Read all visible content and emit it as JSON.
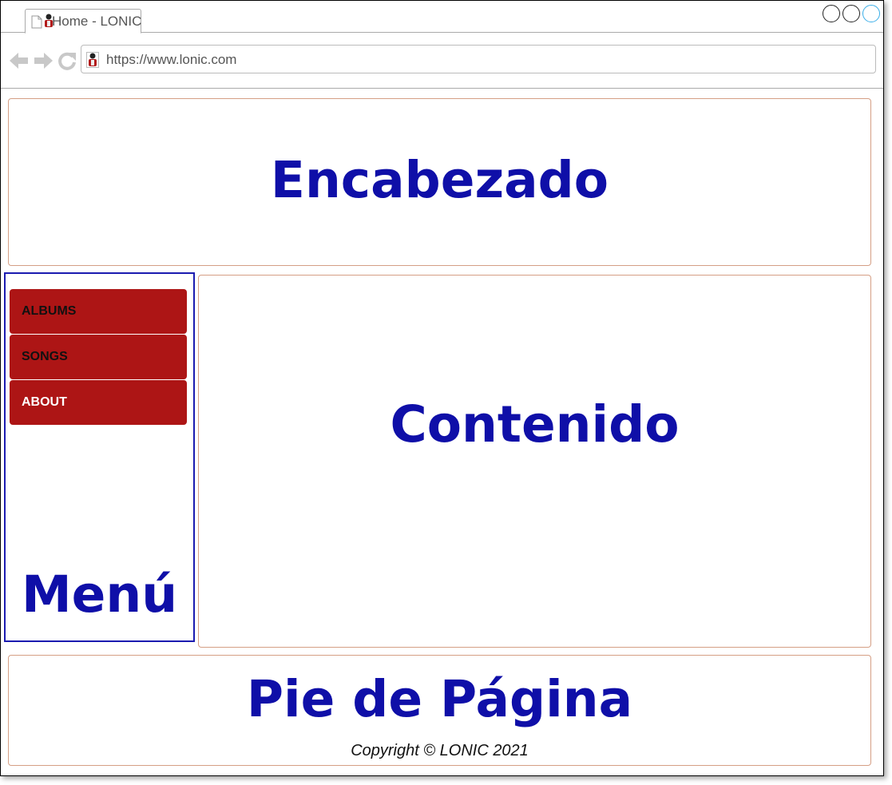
{
  "browser": {
    "tab_title": "Home - LONIC",
    "url": "https://www.lonic.com",
    "icons": {
      "tab_page": "page-icon",
      "favicon": "lonic-favicon",
      "back": "back-arrow-icon",
      "forward": "forward-arrow-icon",
      "reload": "reload-icon"
    }
  },
  "header": {
    "title": "Encabezado"
  },
  "menu": {
    "title": "Menú",
    "items": [
      {
        "label": "ALBUMS"
      },
      {
        "label": "SONGS"
      },
      {
        "label": "ABOUT"
      }
    ]
  },
  "content": {
    "title": "Contenido"
  },
  "footer": {
    "title": "Pie de Página",
    "copyright": "Copyright © LONIC 2021"
  },
  "colors": {
    "region_title": "#0f0fa8",
    "menu_item_bg": "#ad1515",
    "region_border": "#d59f85",
    "menu_border": "#1b1bb0"
  }
}
